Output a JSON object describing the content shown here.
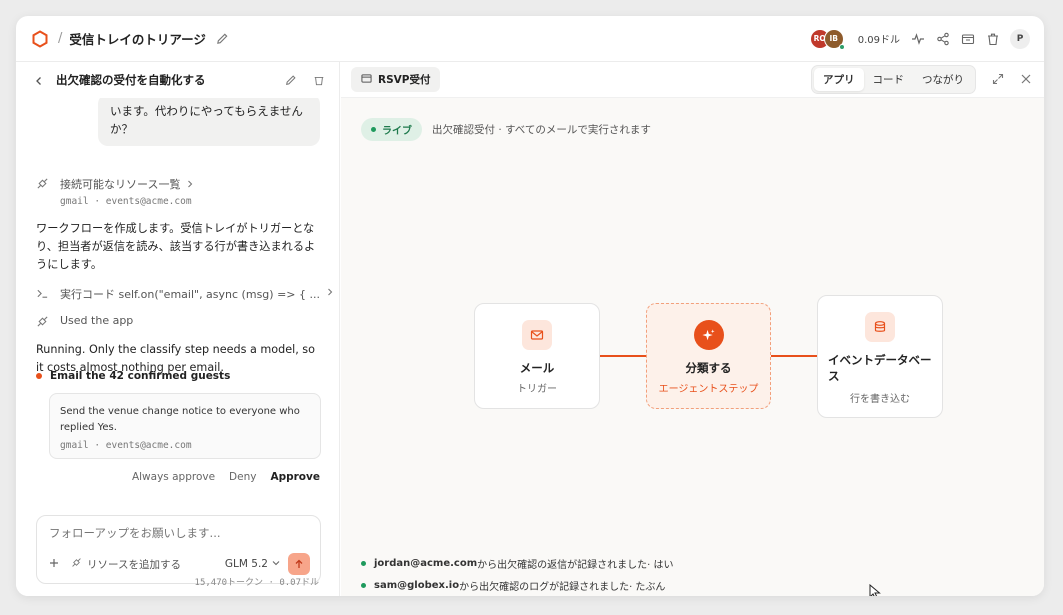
{
  "header": {
    "breadcrumb_sep": "/",
    "title": "受信トレイのトリアージ",
    "avatars": [
      "RO",
      "IB"
    ],
    "cost": "0.09ドル",
    "user_initial": "P"
  },
  "left": {
    "panel_title": "出欠確認の受付を自動化する",
    "user_message": "います。代わりにやってもらえませんか？",
    "tool1": {
      "label": "接続可能なリソース一覧",
      "sub": "gmail · events@acme.com"
    },
    "reply1": "ワークフローを作成します。受信トレイがトリガーとなり、担当者が返信を読み、該当する行が書き込まれるようにします。",
    "tool2": {
      "label": "実行コード self.on(\"email\", async (msg) => { ..."
    },
    "tool3": {
      "label": "Used the app"
    },
    "reply2": "Running. Only the classify step needs a model, so it costs almost nothing per email.",
    "task": {
      "title": "Email the 42 confirmed guests",
      "body": "Send the venue change notice to everyone who replied Yes.",
      "source": "gmail · events@acme.com"
    },
    "actions": {
      "always": "Always approve",
      "deny": "Deny",
      "approve": "Approve"
    },
    "composer": {
      "placeholder": "フォローアップをお願いします...",
      "add_resource": "リソースを追加する",
      "model": "GLM 5.2"
    },
    "tokens": "15,470トークン · 0.07ドル"
  },
  "right": {
    "chip": "RSVP受付",
    "tabs": [
      "アプリ",
      "コード",
      "つながり"
    ],
    "active_tab": "アプリ",
    "live": "ライブ",
    "status": "出欠確認受付 · すべてのメールで実行されます",
    "nodes": [
      {
        "title": "メール",
        "sub": "トリガー",
        "icon": "mail-icon"
      },
      {
        "title": "分類する",
        "sub": "エージェントステップ",
        "icon": "sparkle-icon"
      },
      {
        "title": "イベントデータベース",
        "sub": "行を書き込む",
        "icon": "database-icon"
      }
    ],
    "logs": [
      {
        "sender": "jordan@acme.com",
        "text": "から出欠確認の返信が記録されました· はい"
      },
      {
        "sender": "sam@globex.io",
        "text": "から出欠確認のログが記録されました· たぶん"
      }
    ]
  },
  "colors": {
    "accent": "#e8501b",
    "live": "#1f9a5d"
  }
}
